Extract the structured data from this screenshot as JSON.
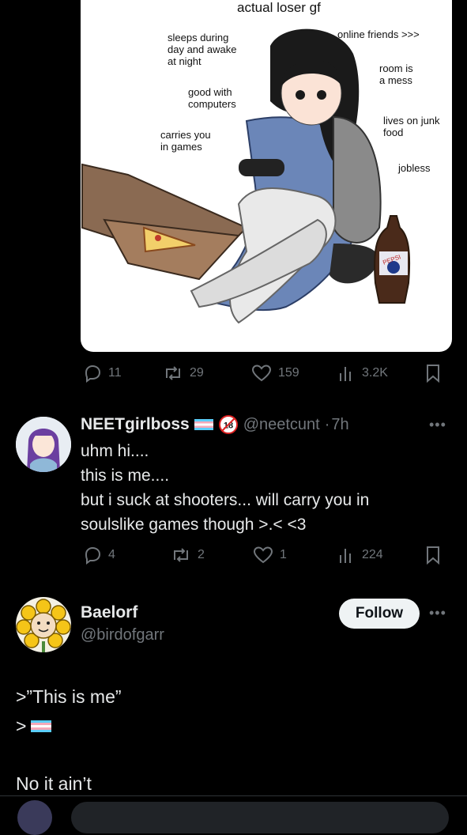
{
  "image_post": {
    "title": "actual loser gf",
    "labels": {
      "sleeps": "sleeps during\nday and awake\nat night",
      "online": "online friends >>>",
      "room": "room is\na mess",
      "computers": "good with\ncomputers",
      "junk": "lives on junk\nfood",
      "carries": "carries you\nin games",
      "jobless": "jobless",
      "bottle": "PEPSI"
    },
    "stats": {
      "replies": "11",
      "reposts": "29",
      "likes": "159",
      "views": "3.2K"
    }
  },
  "reply1": {
    "name": "NEETgirlboss",
    "age_badge": "18",
    "handle": "@neetcunt",
    "sep": "·",
    "time": "7h",
    "lines": [
      "uhm hi....",
      "this is me....",
      "but i suck at shooters... will carry you in",
      "soulslike games though >.< <3"
    ],
    "stats": {
      "replies": "4",
      "reposts": "2",
      "likes": "1",
      "views": "224"
    }
  },
  "reply2": {
    "name": "Baelorf",
    "handle": "@birdofgarr",
    "follow_label": "Follow",
    "lines": [
      ">”This is me”",
      ">",
      "No it ain’t"
    ]
  },
  "colors": {
    "background": "#000000",
    "text": "#e7e9ea",
    "muted": "#71767b",
    "button": "#eff3f4"
  }
}
